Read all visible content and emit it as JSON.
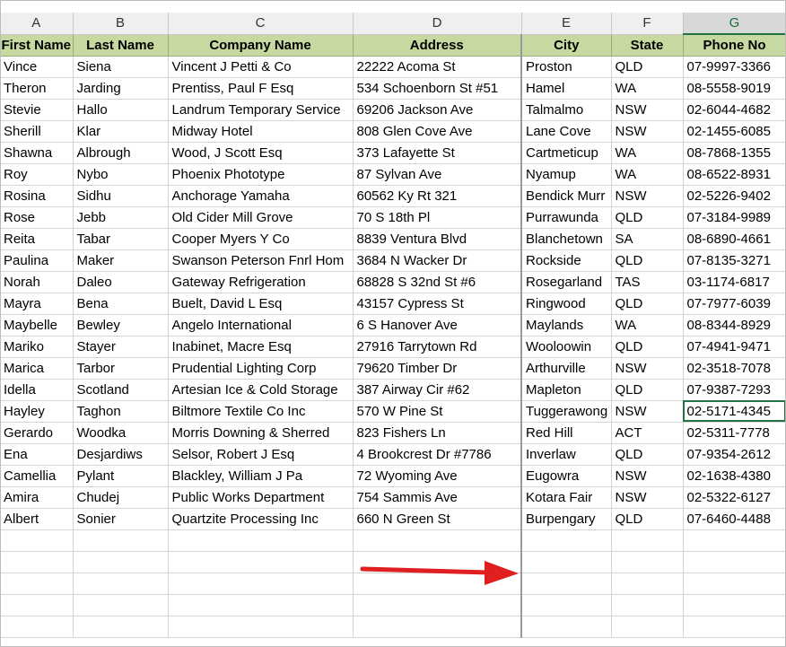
{
  "columns": [
    "A",
    "B",
    "C",
    "D",
    "E",
    "F",
    "G"
  ],
  "headers": [
    "First Name",
    "Last Name",
    "Company Name",
    "Address",
    "City",
    "State",
    "Phone No"
  ],
  "rows": [
    [
      "Vince",
      "Siena",
      "Vincent J Petti & Co",
      "22222 Acoma St",
      "Proston",
      "QLD",
      "07-9997-3366"
    ],
    [
      "Theron",
      "Jarding",
      "Prentiss, Paul F Esq",
      "534 Schoenborn St #51",
      "Hamel",
      "WA",
      "08-5558-9019"
    ],
    [
      "Stevie",
      "Hallo",
      "Landrum Temporary Service",
      "69206 Jackson Ave",
      "Talmalmo",
      "NSW",
      "02-6044-4682"
    ],
    [
      "Sherill",
      "Klar",
      "Midway Hotel",
      "808 Glen Cove Ave",
      "Lane Cove",
      "NSW",
      "02-1455-6085"
    ],
    [
      "Shawna",
      "Albrough",
      "Wood, J Scott Esq",
      "373 Lafayette St",
      "Cartmeticup",
      "WA",
      "08-7868-1355"
    ],
    [
      "Roy",
      "Nybo",
      "Phoenix Phototype",
      "87 Sylvan Ave",
      "Nyamup",
      "WA",
      "08-6522-8931"
    ],
    [
      "Rosina",
      "Sidhu",
      "Anchorage Yamaha",
      "60562 Ky Rt 321",
      "Bendick Murr",
      "NSW",
      "02-5226-9402"
    ],
    [
      "Rose",
      "Jebb",
      "Old Cider Mill Grove",
      "70 S 18th Pl",
      "Purrawunda",
      "QLD",
      "07-3184-9989"
    ],
    [
      "Reita",
      "Tabar",
      "Cooper Myers Y Co",
      "8839 Ventura Blvd",
      "Blanchetown",
      "SA",
      "08-6890-4661"
    ],
    [
      "Paulina",
      "Maker",
      "Swanson Peterson Fnrl Hom",
      "3684 N Wacker Dr",
      "Rockside",
      "QLD",
      "07-8135-3271"
    ],
    [
      "Norah",
      "Daleo",
      "Gateway Refrigeration",
      "68828 S 32nd St #6",
      "Rosegarland",
      "TAS",
      "03-1174-6817"
    ],
    [
      "Mayra",
      "Bena",
      "Buelt, David L Esq",
      "43157 Cypress St",
      "Ringwood",
      "QLD",
      "07-7977-6039"
    ],
    [
      "Maybelle",
      "Bewley",
      "Angelo International",
      "6 S Hanover Ave",
      "Maylands",
      "WA",
      "08-8344-8929"
    ],
    [
      "Mariko",
      "Stayer",
      "Inabinet, Macre Esq",
      "27916 Tarrytown Rd",
      "Wooloowin",
      "QLD",
      "07-4941-9471"
    ],
    [
      "Marica",
      "Tarbor",
      "Prudential Lighting Corp",
      "79620 Timber Dr",
      "Arthurville",
      "NSW",
      "02-3518-7078"
    ],
    [
      "Idella",
      "Scotland",
      "Artesian Ice & Cold Storage",
      "387 Airway Cir #62",
      "Mapleton",
      "QLD",
      "07-9387-7293"
    ],
    [
      "Hayley",
      "Taghon",
      "Biltmore Textile Co Inc",
      "570 W Pine St",
      "Tuggerawong",
      "NSW",
      "02-5171-4345"
    ],
    [
      "Gerardo",
      "Woodka",
      "Morris Downing & Sherred",
      "823 Fishers Ln",
      "Red Hill",
      "ACT",
      "02-5311-7778"
    ],
    [
      "Ena",
      "Desjardiws",
      "Selsor, Robert J Esq",
      "4 Brookcrest Dr #7786",
      "Inverlaw",
      "QLD",
      "07-9354-2612"
    ],
    [
      "Camellia",
      "Pylant",
      "Blackley, William J Pa",
      "72 Wyoming Ave",
      "Eugowra",
      "NSW",
      "02-1638-4380"
    ],
    [
      "Amira",
      "Chudej",
      "Public Works Department",
      "754 Sammis Ave",
      "Kotara Fair",
      "NSW",
      "02-5322-6127"
    ],
    [
      "Albert",
      "Sonier",
      "Quartzite Processing Inc",
      "660 N Green St",
      "Burpengary",
      "QLD",
      "07-6460-4488"
    ]
  ],
  "empty_row_count": 5,
  "selected_cell": {
    "row": 16,
    "col": 6
  },
  "active_column": "G",
  "annotation": {
    "type": "red-arrow",
    "color": "#e02020"
  }
}
